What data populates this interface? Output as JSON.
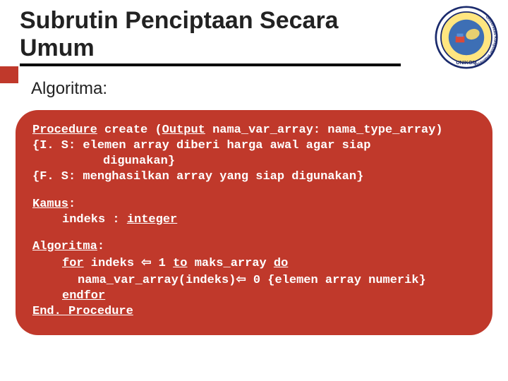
{
  "title": "Subrutin Penciptaan Secara Umum",
  "subtitle": "Algoritma:",
  "logo": {
    "name": "UNIKOM",
    "full": "Universitas Komputer Indonesia"
  },
  "code": {
    "sig": {
      "kw_procedure": "Procedure",
      "name": " create (",
      "kw_output": "Output",
      "rest": " nama_var_array: nama_type_array)"
    },
    "is_line1": "{I. S: elemen array diberi harga awal agar siap",
    "is_line2": "digunakan}",
    "fs": "{F. S: menghasilkan array yang siap digunakan}",
    "kamus": {
      "heading": "Kamus",
      "colon": ":",
      "line": "indeks : ",
      "kw_integer": "integer"
    },
    "algo": {
      "heading": "Algoritma",
      "colon": ":",
      "kw_for": "for",
      "for_mid": " indeks ",
      "arrow": "⇦",
      "for_mid2": " 1 ",
      "kw_to": "to",
      "for_mid3": " maks_array ",
      "kw_do": "do",
      "assign_left": "nama_var_array(indeks)",
      "assign_right": " 0 {elemen array numerik}",
      "kw_endfor": "endfor",
      "kw_endproc": "End. Procedure"
    }
  }
}
